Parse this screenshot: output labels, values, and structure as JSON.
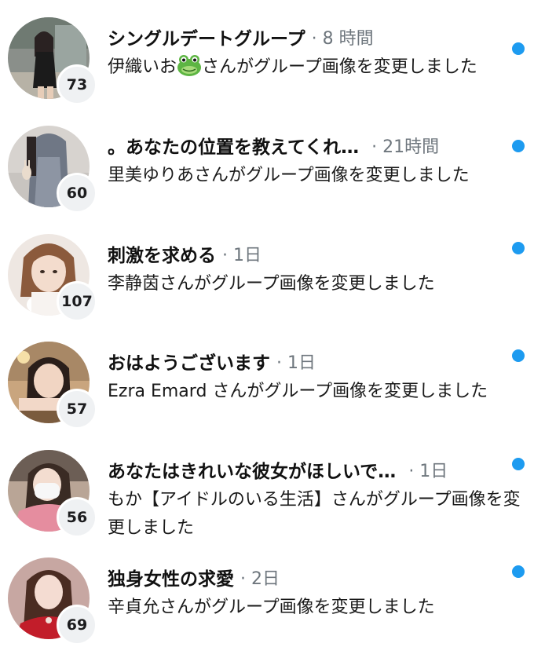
{
  "colors": {
    "unread_dot": "#1d9bf0",
    "meta_text": "#6e767d",
    "badge_bg": "#eff1f3"
  },
  "conversations": [
    {
      "title": "シングルデートグループ",
      "time": "· 8 時間",
      "member_count": "73",
      "message_before": "伊織いお",
      "emoji": "frog-face-icon",
      "message_after": "さんがグループ画像を変更しました",
      "unread": true
    },
    {
      "title": "。あなたの位置を教えてくれ…",
      "time": "· 21時間",
      "member_count": "60",
      "message": "里美ゆりあさんがグループ画像を変更しました",
      "unread": true
    },
    {
      "title": "刺激を求める",
      "time": "· 1日",
      "member_count": "107",
      "message": "李静茵さんがグループ画像を変更しました",
      "unread": true
    },
    {
      "title": "おはようございます",
      "time": "· 1日",
      "member_count": "57",
      "message": "Ezra Emard さんがグループ画像を変更しました",
      "unread": true
    },
    {
      "title": "あなたはきれいな彼女がほしいで…",
      "time": "· 1日",
      "member_count": "56",
      "message": "もか【アイドルのいる生活】さんがグループ画像を変更しました",
      "unread": true
    },
    {
      "title": "独身女性の求愛",
      "time": "· 2日",
      "member_count": "69",
      "message": "辛貞允さんがグループ画像を変更しました",
      "unread": true
    }
  ]
}
